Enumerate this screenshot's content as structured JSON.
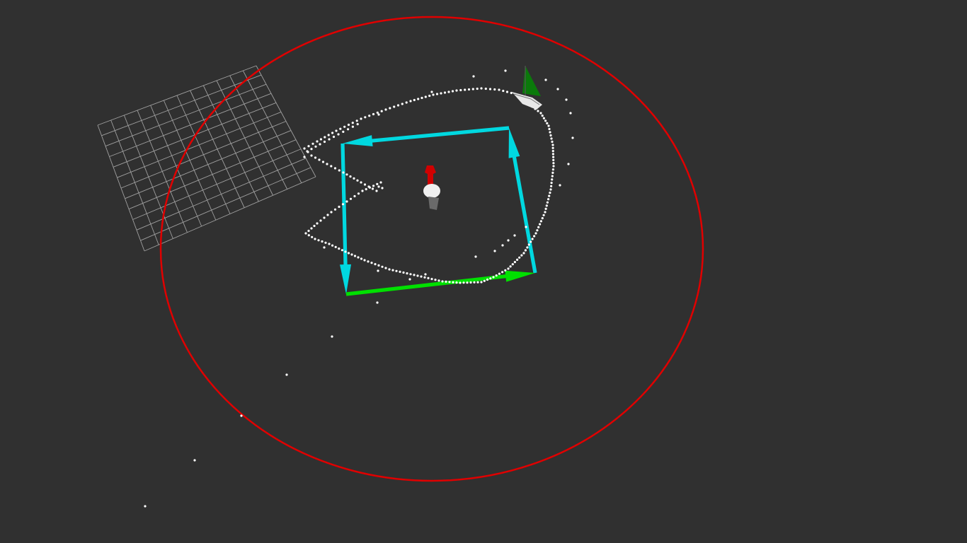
{
  "viewer": {
    "background_color": "#303030"
  },
  "colors": {
    "grid": "#a0a0a0",
    "boundary_circle": "#e00000",
    "waypoint_arrows": "#00d8e0",
    "active_arrow": "#00e000",
    "trail_points": "#ffffff",
    "boat_sail": "#0a7a0a",
    "boat_hull": "#e8e8e8",
    "buoy_marker": "#d00000",
    "buoy_body": "#f0f0f0"
  },
  "icons": {
    "boat": "sailboat-icon",
    "buoy": "buoy-marker-icon",
    "grid": "grid-plane",
    "boundary": "boundary-circle"
  }
}
